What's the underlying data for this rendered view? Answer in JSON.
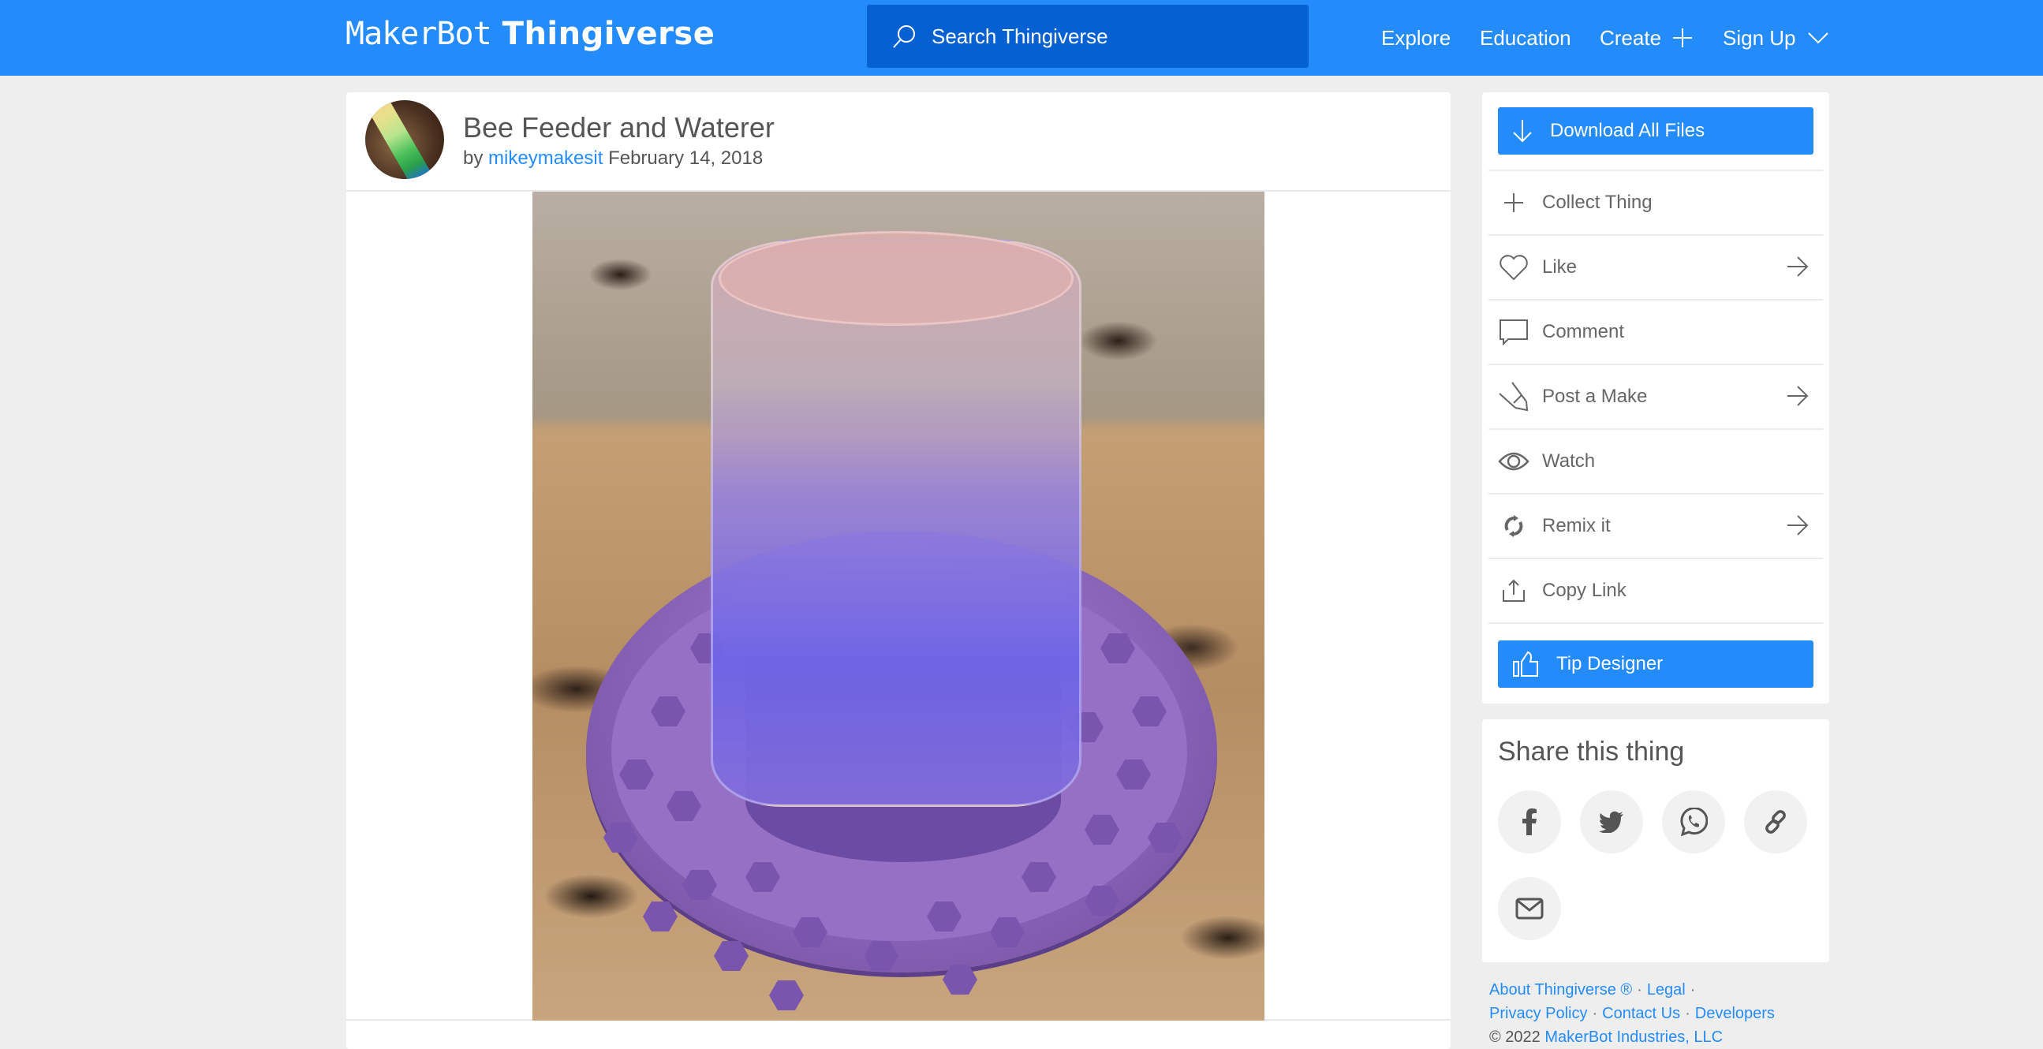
{
  "header": {
    "logo_maker": "MakerBot",
    "logo_thingiverse": "Thingiverse",
    "search_placeholder": "Search Thingiverse",
    "nav": {
      "explore": "Explore",
      "education": "Education",
      "create": "Create",
      "signup": "Sign Up"
    },
    "brand_color": "#248bfb",
    "search_color": "#0561d1"
  },
  "thing": {
    "title": "Bee Feeder and Waterer",
    "by_label": "by",
    "author": "mikeymakesit",
    "date": "February 14, 2018",
    "image_alt": "Purple 3D-printed bee feeder base with inverted mason jar of water on a granite countertop"
  },
  "actions": {
    "download": "Download All Files",
    "items": [
      {
        "label": "Collect Thing",
        "icon": "plus-icon",
        "arrow": false
      },
      {
        "label": "Like",
        "icon": "heart-icon",
        "arrow": true
      },
      {
        "label": "Comment",
        "icon": "comment-icon",
        "arrow": false
      },
      {
        "label": "Post a Make",
        "icon": "pencil-icon",
        "arrow": true
      },
      {
        "label": "Watch",
        "icon": "eye-icon",
        "arrow": false
      },
      {
        "label": "Remix it",
        "icon": "remix-icon",
        "arrow": true
      },
      {
        "label": "Copy Link",
        "icon": "share-upload-icon",
        "arrow": false
      }
    ],
    "tip": "Tip Designer"
  },
  "share": {
    "title": "Share this thing",
    "buttons": [
      "facebook-icon",
      "twitter-icon",
      "whatsapp-icon",
      "link-icon",
      "email-icon"
    ]
  },
  "footer": {
    "about": "About Thingiverse ®",
    "legal": "Legal",
    "privacy": "Privacy Policy",
    "contact": "Contact Us",
    "developers": "Developers",
    "copyright": "©  2022",
    "company": "MakerBot Industries, LLC",
    "separator": "·"
  }
}
